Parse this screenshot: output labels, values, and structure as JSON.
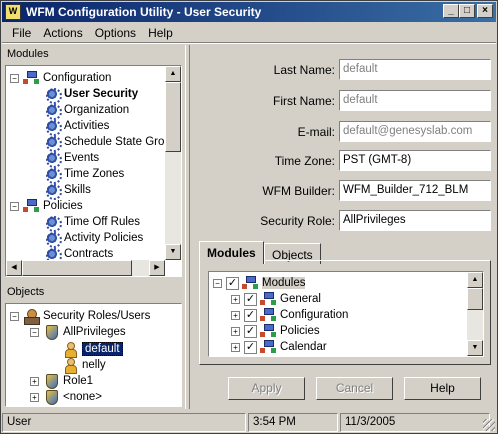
{
  "window": {
    "title": "WFM Configuration Utility - User Security",
    "app_icon_text": "W",
    "minimize": "_",
    "maximize": "□",
    "close": "×"
  },
  "menu": {
    "file": "File",
    "actions": "Actions",
    "options": "Options",
    "help": "Help"
  },
  "modules_panel": {
    "label": "Modules",
    "items": [
      {
        "label": "Configuration",
        "expander": "−",
        "icon": "network-icon"
      },
      {
        "label": "User Security",
        "icon": "gear-icon",
        "selected": true
      },
      {
        "label": "Organization",
        "icon": "gear-icon"
      },
      {
        "label": "Activities",
        "icon": "gear-icon"
      },
      {
        "label": "Schedule State Grou",
        "icon": "gear-icon"
      },
      {
        "label": "Events",
        "icon": "gear-icon"
      },
      {
        "label": "Time Zones",
        "icon": "gear-icon"
      },
      {
        "label": "Skills",
        "icon": "gear-icon"
      },
      {
        "label": "Policies",
        "expander": "−",
        "icon": "network-icon"
      },
      {
        "label": "Time Off Rules",
        "icon": "gear-icon"
      },
      {
        "label": "Activity Policies",
        "icon": "gear-icon"
      },
      {
        "label": "Contracts",
        "icon": "gear-icon"
      }
    ]
  },
  "objects_panel": {
    "label": "Objects",
    "items": [
      {
        "label": "Security Roles/Users",
        "expander": "−",
        "icon": "roles-icon"
      },
      {
        "label": "AllPrivileges",
        "expander": "−",
        "icon": "shield-icon"
      },
      {
        "label": "default",
        "icon": "user-icon",
        "selected": true
      },
      {
        "label": "nelly",
        "icon": "user-icon"
      },
      {
        "label": "Role1",
        "expander": "+",
        "icon": "shield-icon"
      },
      {
        "label": "<none>",
        "expander": "+",
        "icon": "shield-icon"
      }
    ]
  },
  "form": {
    "last_name_label": "Last Name:",
    "last_name_value": "default",
    "first_name_label": "First Name:",
    "first_name_value": "default",
    "email_label": "E-mail:",
    "email_value": "default@genesyslab.com",
    "time_zone_label": "Time Zone:",
    "time_zone_value": "PST (GMT-8)",
    "wfm_builder_label": "WFM Builder:",
    "wfm_builder_value": "WFM_Builder_712_BLM",
    "security_role_label": "Security Role:",
    "security_role_value": "AllPrivileges"
  },
  "tabs": {
    "modules": "Modules",
    "objects": "Objects"
  },
  "permissions_tree": [
    {
      "label": "Modules",
      "expander": "−",
      "checked": true
    },
    {
      "label": "General",
      "expander": "+",
      "checked": true
    },
    {
      "label": "Configuration",
      "expander": "+",
      "checked": true
    },
    {
      "label": "Policies",
      "expander": "+",
      "checked": true
    },
    {
      "label": "Calendar",
      "expander": "+",
      "checked": true
    }
  ],
  "buttons": {
    "apply": "Apply",
    "cancel": "Cancel",
    "help": "Help"
  },
  "status": {
    "user": "User",
    "time": "3:54 PM",
    "date": "11/3/2005"
  }
}
